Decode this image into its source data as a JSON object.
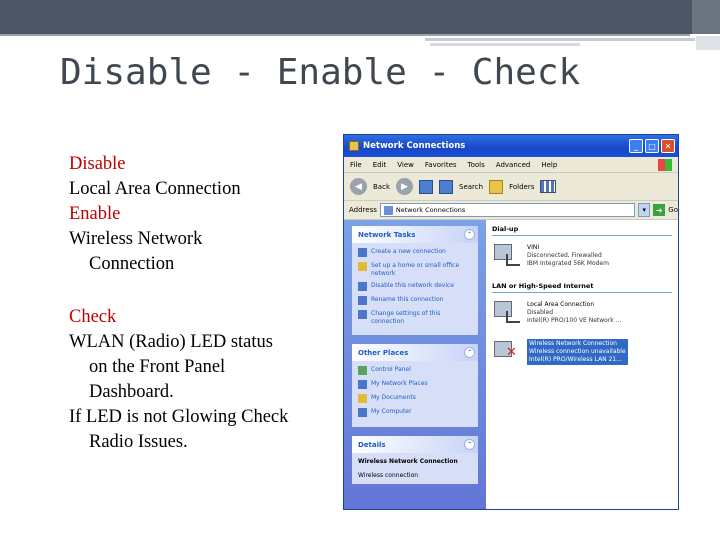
{
  "slide": {
    "title": "Disable - Enable - Check"
  },
  "bullets": {
    "disable_label": "Disable",
    "disable_item": "Local Area Connection",
    "enable_label": "Enable",
    "enable_item_line1": "Wireless Network",
    "enable_item_line2": "Connection",
    "check_label": "Check",
    "check_item1_line1": "WLAN (Radio) LED status",
    "check_item1_line2": "on the Front Panel",
    "check_item1_line3": "Dashboard.",
    "check_item2_line1": "If LED is not Glowing Check",
    "check_item2_line2": "Radio Issues."
  },
  "window": {
    "title": "Network Connections",
    "menu": [
      "File",
      "Edit",
      "View",
      "Favorites",
      "Tools",
      "Advanced",
      "Help"
    ],
    "toolbar": {
      "back": "Back",
      "search": "Search",
      "folders": "Folders"
    },
    "address_label": "Address",
    "address_value": "Network Connections",
    "go_label": "Go",
    "network_tasks": {
      "header": "Network Tasks",
      "items": [
        "Create a new connection",
        "Set up a home or small office network",
        "Disable this network device",
        "Rename this connection",
        "Change settings of this connection"
      ]
    },
    "other_places": {
      "header": "Other Places",
      "items": [
        "Control Panel",
        "My Network Places",
        "My Documents",
        "My Computer"
      ]
    },
    "details": {
      "header": "Details",
      "name": "Wireless Network Connection",
      "type": "Wireless connection"
    },
    "groups": {
      "dialup": "Dial-up",
      "lan": "LAN or High-Speed Internet"
    },
    "connections": [
      {
        "name": "VINI",
        "status": "Disconnected, Firewalled",
        "device": "IBM Integrated 56K Modem"
      },
      {
        "name": "Local Area Connection",
        "status": "Disabled",
        "device": "Intel(R) PRO/100 VE Network ..."
      },
      {
        "name": "Wireless Network Connection",
        "status": "Wireless connection unavailable",
        "device": "Intel(R) PRO/Wireless LAN 21..."
      }
    ]
  }
}
